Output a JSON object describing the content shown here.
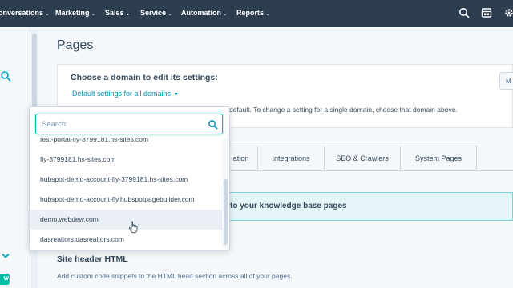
{
  "nav": {
    "items": [
      "onversations",
      "Marketing",
      "Sales",
      "Service",
      "Automation",
      "Reports"
    ],
    "chevron": "⌄",
    "icons": [
      "search-icon",
      "marketplace-icon",
      "settings-icon"
    ]
  },
  "sidebar": {
    "badge": "W",
    "icons": [
      "search-icon",
      "chevron-down-icon"
    ]
  },
  "page": {
    "title": "Pages",
    "choose_label": "Choose a domain to edit its settings:",
    "domain_link": "Default settings for all domains",
    "default_text": "default. To change a setting for a single domain, choose that domain above.",
    "side_button": "M"
  },
  "tabs": [
    "ation",
    "Integrations",
    "SEO & Crawlers",
    "System Pages"
  ],
  "banner": {
    "text": "to your knowledge base pages"
  },
  "section": {
    "title": "Site header HTML",
    "description": "Add custom code snippets to the HTML head section across all of your pages."
  },
  "dropdown": {
    "search_placeholder": "Search",
    "items": [
      "test-portal-fly-3799181.hs-sites.com",
      "fly-3799181.hs-sites.com",
      "hubspot-demo-account-fly-3799181.hs-sites.com",
      "hubspot-demo-account-fly.hubspotpagebuilder.com",
      "demo.webdew.com",
      "dasrealtors.dasrealtors.com"
    ],
    "hovered_item": "demo.webdew.com"
  },
  "colors": {
    "nav_bg": "#2d3e50",
    "accent": "#0091ae",
    "focus": "#00bda5",
    "banner_bg": "#e5f5f8"
  }
}
